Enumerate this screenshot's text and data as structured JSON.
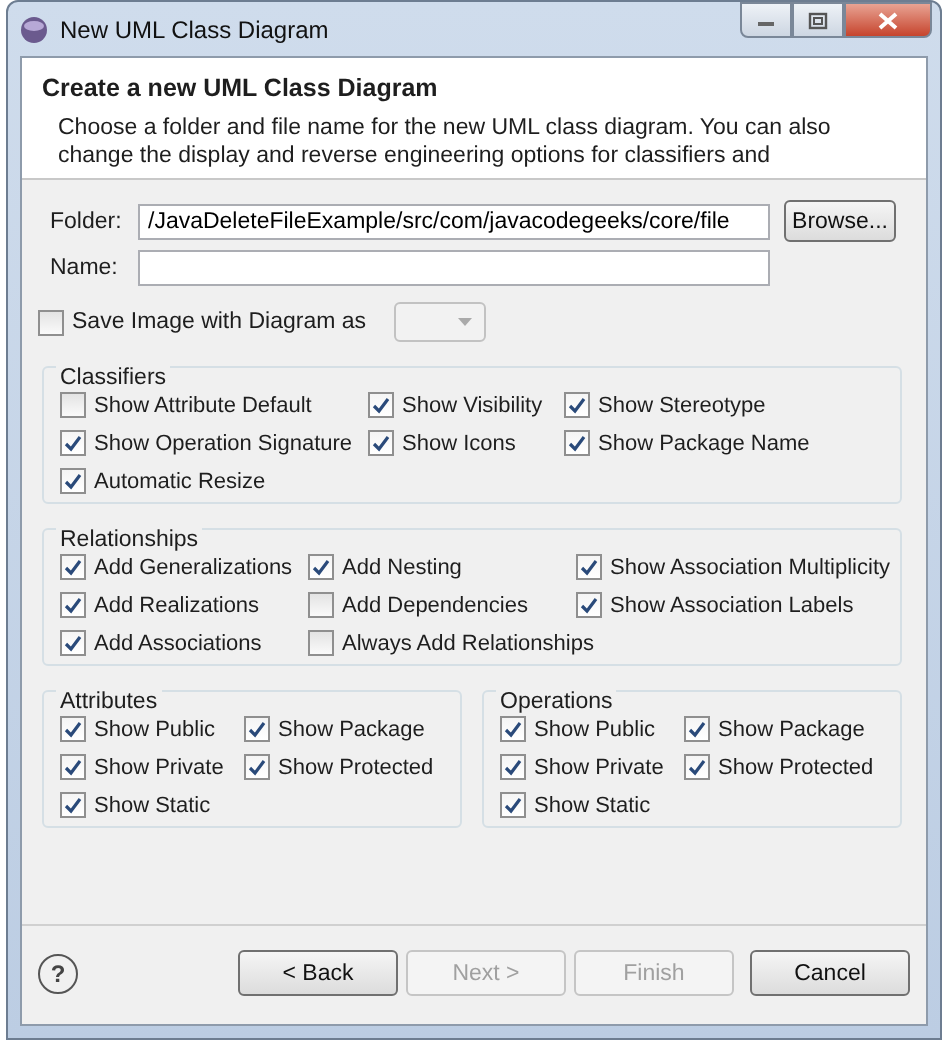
{
  "window": {
    "title": "New UML Class Diagram"
  },
  "header": {
    "title": "Create a new UML Class Diagram",
    "description": "Choose a folder and file name for the new UML class diagram. You can also change the display and reverse engineering options for classifiers and"
  },
  "folder": {
    "label": "Folder:",
    "value": "/JavaDeleteFileExample/src/com/javacodegeeks/core/file"
  },
  "browse_button": "Browse...",
  "name": {
    "label": "Name:"
  },
  "save_image": {
    "label": "Save Image with Diagram as",
    "checked": false
  },
  "groups": [
    {
      "title": "Classifiers",
      "options": [
        {
          "label": "Show Attribute Default",
          "checked": false
        },
        {
          "label": "Show Visibility",
          "checked": true
        },
        {
          "label": "Show Stereotype",
          "checked": true
        },
        {
          "label": "Show Operation Signature",
          "checked": true
        },
        {
          "label": "Show Icons",
          "checked": true
        },
        {
          "label": "Show Package Name",
          "checked": true
        },
        {
          "label": "Automatic Resize",
          "checked": true
        }
      ]
    },
    {
      "title": "Relationships",
      "options": [
        {
          "label": "Add Generalizations",
          "checked": true
        },
        {
          "label": "Add Nesting",
          "checked": true
        },
        {
          "label": "Show Association Multiplicity",
          "checked": true
        },
        {
          "label": "Add Realizations",
          "checked": true
        },
        {
          "label": "Add Dependencies",
          "checked": false
        },
        {
          "label": "Show Association Labels",
          "checked": true
        },
        {
          "label": "Add Associations",
          "checked": true
        },
        {
          "label": "Always Add Relationships",
          "checked": false
        }
      ]
    },
    {
      "title": "Attributes",
      "options": [
        {
          "label": "Show Public",
          "checked": true
        },
        {
          "label": "Show Package",
          "checked": true
        },
        {
          "label": "Show Private",
          "checked": true
        },
        {
          "label": "Show Protected",
          "checked": true
        },
        {
          "label": "Show Static",
          "checked": true
        }
      ]
    },
    {
      "title": "Operations",
      "options": [
        {
          "label": "Show Public",
          "checked": true
        },
        {
          "label": "Show Package",
          "checked": true
        },
        {
          "label": "Show Private",
          "checked": true
        },
        {
          "label": "Show Protected",
          "checked": true
        },
        {
          "label": "Show Static",
          "checked": true
        }
      ]
    }
  ],
  "help": "?",
  "buttons": [
    {
      "label": "< Back",
      "disabled": false
    },
    {
      "label": "Next >",
      "disabled": true
    },
    {
      "label": "Finish",
      "disabled": true
    },
    {
      "label": "Cancel",
      "disabled": false
    }
  ]
}
